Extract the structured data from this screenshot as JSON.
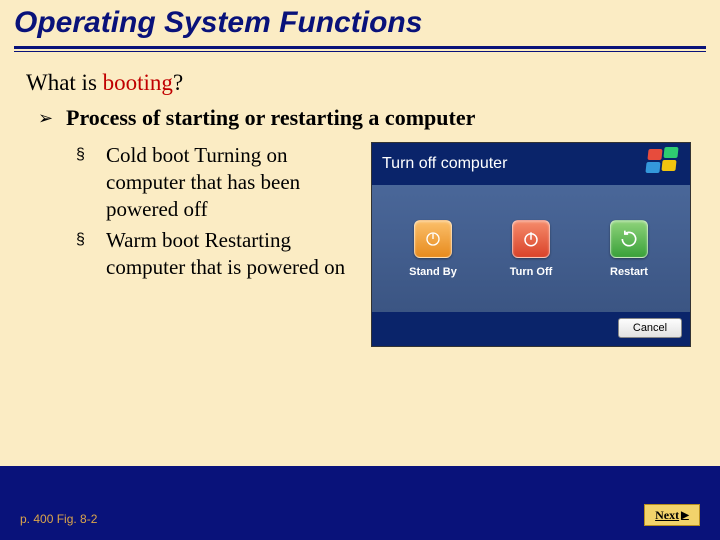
{
  "title": "Operating System Functions",
  "question_prefix": "What is ",
  "question_keyword": "booting",
  "question_suffix": "?",
  "level1": {
    "bullet": "➢",
    "text": "Process of starting or restarting a computer"
  },
  "level2": [
    {
      "bullet": "§",
      "heading": "Cold boot",
      "desc": " Turning on computer that has been powered off"
    },
    {
      "bullet": "§",
      "heading": "Warm boot",
      "desc": " Restarting computer that is powered on"
    }
  ],
  "shutdown": {
    "header": "Turn off computer",
    "options": [
      {
        "name": "standby",
        "label": "Stand By"
      },
      {
        "name": "turnoff",
        "label": "Turn Off"
      },
      {
        "name": "restart",
        "label": "Restart"
      }
    ],
    "cancel": "Cancel"
  },
  "page_ref": "p. 400 Fig. 8-2",
  "next_label": "Next"
}
